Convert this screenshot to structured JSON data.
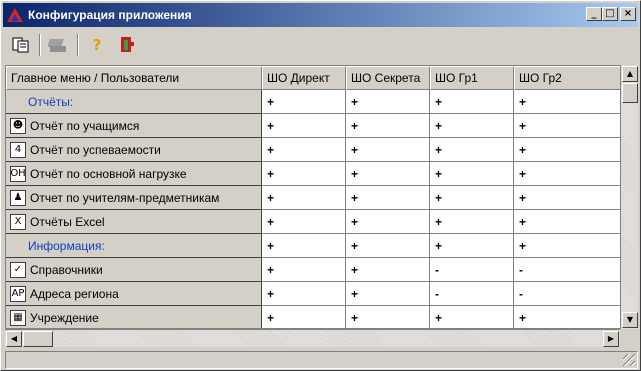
{
  "window": {
    "title": "Конфигурация приложения",
    "controls": {
      "minimize": "_",
      "maximize": "□",
      "close": "×"
    }
  },
  "toolbar": {
    "icons": [
      "settings-icon",
      "print-icon",
      "help-icon",
      "exit-icon"
    ],
    "help_glyph": "?",
    "exit_glyph": "⇥"
  },
  "grid": {
    "headers": [
      "Главное меню / Пользователи",
      "ШО  Директ",
      "ШО  Секрета",
      "ШО  Гр1",
      "ШО  Гр2"
    ],
    "rows": [
      {
        "label": "Отчёты:",
        "section": true,
        "icon": "",
        "values": [
          "+",
          "+",
          "+",
          "+"
        ]
      },
      {
        "label": "Отчёт по учащимся",
        "section": false,
        "icon": "pupils-icon",
        "icon_glyph": "☻",
        "values": [
          "+",
          "+",
          "+",
          "+"
        ]
      },
      {
        "label": "Отчёт по успеваемости",
        "section": false,
        "icon": "grades-icon",
        "icon_glyph": "4",
        "values": [
          "+",
          "+",
          "+",
          "+"
        ]
      },
      {
        "label": "Отчёт по основной нагрузке",
        "section": false,
        "icon": "workload-icon",
        "icon_glyph": "ОН",
        "values": [
          "+",
          "+",
          "+",
          "+"
        ]
      },
      {
        "label": "Отчет по учителям-предметникам",
        "section": false,
        "icon": "teachers-icon",
        "icon_glyph": "♟",
        "values": [
          "+",
          "+",
          "+",
          "+"
        ]
      },
      {
        "label": "Отчёты Excel",
        "section": false,
        "icon": "excel-icon",
        "icon_glyph": "X",
        "values": [
          "+",
          "+",
          "+",
          "+"
        ]
      },
      {
        "label": "Информация:",
        "section": true,
        "icon": "",
        "values": [
          "+",
          "+",
          "+",
          "+"
        ]
      },
      {
        "label": "Справочники",
        "section": false,
        "icon": "reference-icon",
        "icon_glyph": "✓",
        "values": [
          "+",
          "+",
          "-",
          "-"
        ]
      },
      {
        "label": "Адреса региона",
        "section": false,
        "icon": "address-icon",
        "icon_glyph": "АР",
        "values": [
          "+",
          "+",
          "-",
          "-"
        ]
      },
      {
        "label": "Учреждение",
        "section": false,
        "icon": "institution-icon",
        "icon_glyph": "▦",
        "values": [
          "+",
          "+",
          "+",
          "+"
        ]
      }
    ]
  },
  "scrollbars": {
    "up": "▲",
    "down": "▼",
    "left": "◀",
    "right": "▶"
  },
  "status_text": ""
}
